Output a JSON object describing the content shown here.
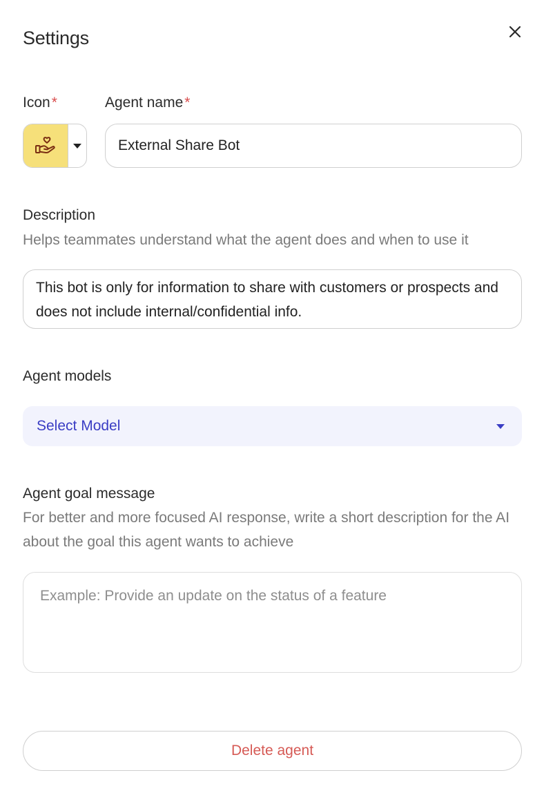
{
  "panel": {
    "title": "Settings"
  },
  "icon_field": {
    "label": "Icon",
    "required_mark": "*",
    "selected_icon": "hand-heart-icon",
    "swatch_color": "#f6e07a"
  },
  "name_field": {
    "label": "Agent name",
    "required_mark": "*",
    "value": "External Share Bot"
  },
  "description_field": {
    "label": "Description",
    "help": "Helps teammates understand what the agent does and when to use it",
    "value": "This bot is only for information to share with customers or prospects and does not include internal/confidential info."
  },
  "models_field": {
    "label": "Agent models",
    "selected": "Select Model"
  },
  "goal_field": {
    "label": "Agent goal message",
    "help": "For better and more focused AI response, write a short description for the AI about the goal this agent wants to achieve",
    "placeholder": "Example: Provide an update on the status of a feature",
    "value": ""
  },
  "actions": {
    "delete_label": "Delete agent"
  },
  "colors": {
    "accent": "#3a3dc4",
    "danger": "#d65a55",
    "required": "#d94c4c",
    "select_bg": "#f2f3fd"
  }
}
